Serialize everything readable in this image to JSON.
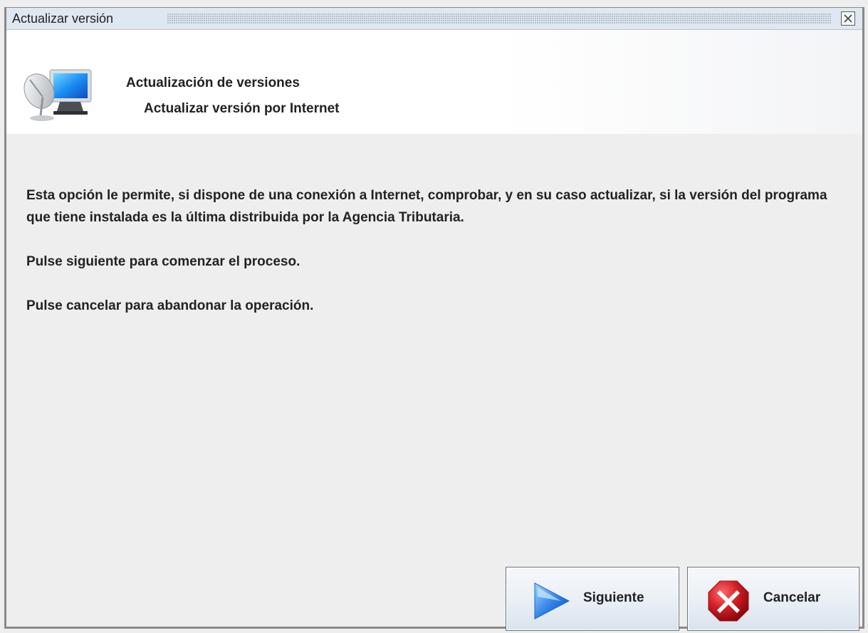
{
  "window": {
    "title": "Actualizar versión",
    "close_icon": "close-icon"
  },
  "header": {
    "icon": "monitor-satellite-icon",
    "title": "Actualización de versiones",
    "subtitle": "Actualizar versión por Internet"
  },
  "content": {
    "paragraphs": [
      "Esta opción le permite, si dispone de una conexión a Internet, comprobar, y en su caso actualizar, si la versión del programa que tiene instalada es la última distribuida por la Agencia Tributaria.",
      "Pulse siguiente para comenzar el proceso.",
      "Pulse cancelar para abandonar la operación."
    ]
  },
  "buttons": {
    "next": {
      "label": "Siguiente",
      "icon": "play-arrow-icon"
    },
    "cancel": {
      "label": "Cancelar",
      "icon": "cancel-icon"
    }
  },
  "colors": {
    "window_background": "#eeeeee",
    "title_bar": "#dfe7f1",
    "next_icon": "#2f7fe6",
    "cancel_icon": "#d21f25"
  }
}
